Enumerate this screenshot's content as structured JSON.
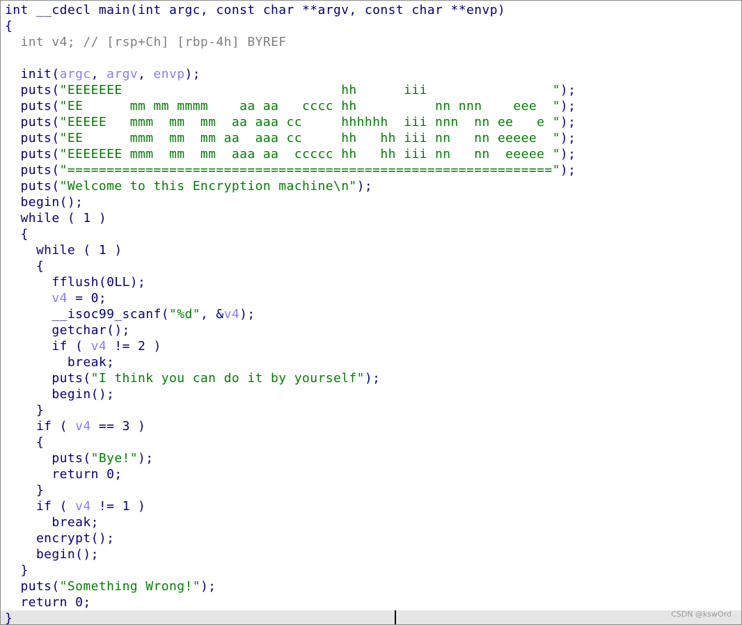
{
  "colors": {
    "kw": "#000080",
    "str": "#008000",
    "var": "#8080ff",
    "cmt": "#808080",
    "bg_current_line": "#e6e6e6"
  },
  "code_lines": [
    [
      {
        "t": "int __cdecl main(int argc, const char **argv, const char **envp)",
        "c": "kw"
      }
    ],
    [
      {
        "t": "{",
        "c": "kw"
      }
    ],
    [
      {
        "t": "  ",
        "c": "kw"
      },
      {
        "t": "int v4; // [rsp+Ch] [rbp-4h] BYREF",
        "c": "cmt"
      }
    ],
    [
      {
        "t": "",
        "c": "kw"
      }
    ],
    [
      {
        "t": "  init(",
        "c": "kw"
      },
      {
        "t": "argc",
        "c": "var"
      },
      {
        "t": ", ",
        "c": "kw"
      },
      {
        "t": "argv",
        "c": "var"
      },
      {
        "t": ", ",
        "c": "kw"
      },
      {
        "t": "envp",
        "c": "var"
      },
      {
        "t": ");",
        "c": "kw"
      }
    ],
    [
      {
        "t": "  puts(",
        "c": "kw"
      },
      {
        "t": "\"EEEEEEE                            hh      iii                \"",
        "c": "str"
      },
      {
        "t": ");",
        "c": "kw"
      }
    ],
    [
      {
        "t": "  puts(",
        "c": "kw"
      },
      {
        "t": "\"EE      mm mm mmmm    aa aa   cccc hh          nn nnn    eee  \"",
        "c": "str"
      },
      {
        "t": ");",
        "c": "kw"
      }
    ],
    [
      {
        "t": "  puts(",
        "c": "kw"
      },
      {
        "t": "\"EEEEE   mmm  mm  mm  aa aaa cc     hhhhhh  iii nnn  nn ee   e \"",
        "c": "str"
      },
      {
        "t": ");",
        "c": "kw"
      }
    ],
    [
      {
        "t": "  puts(",
        "c": "kw"
      },
      {
        "t": "\"EE      mmm  mm  mm aa  aaa cc     hh   hh iii nn   nn eeeee  \"",
        "c": "str"
      },
      {
        "t": ");",
        "c": "kw"
      }
    ],
    [
      {
        "t": "  puts(",
        "c": "kw"
      },
      {
        "t": "\"EEEEEEE mmm  mm  mm  aaa aa  ccccc hh   hh iii nn   nn  eeeee \"",
        "c": "str"
      },
      {
        "t": ");",
        "c": "kw"
      }
    ],
    [
      {
        "t": "  puts(",
        "c": "kw"
      },
      {
        "t": "\"==============================================================\"",
        "c": "str"
      },
      {
        "t": ");",
        "c": "kw"
      }
    ],
    [
      {
        "t": "  puts(",
        "c": "kw"
      },
      {
        "t": "\"Welcome to this Encryption machine\\n\"",
        "c": "str"
      },
      {
        "t": ");",
        "c": "kw"
      }
    ],
    [
      {
        "t": "  begin();",
        "c": "kw"
      }
    ],
    [
      {
        "t": "  while ( 1 )",
        "c": "kw"
      }
    ],
    [
      {
        "t": "  {",
        "c": "kw"
      }
    ],
    [
      {
        "t": "    while ( 1 )",
        "c": "kw"
      }
    ],
    [
      {
        "t": "    {",
        "c": "kw"
      }
    ],
    [
      {
        "t": "      fflush(0LL);",
        "c": "kw"
      }
    ],
    [
      {
        "t": "      ",
        "c": "kw"
      },
      {
        "t": "v4",
        "c": "var"
      },
      {
        "t": " = 0;",
        "c": "kw"
      }
    ],
    [
      {
        "t": "      __isoc99_scanf(",
        "c": "kw"
      },
      {
        "t": "\"%d\"",
        "c": "str"
      },
      {
        "t": ", &",
        "c": "kw"
      },
      {
        "t": "v4",
        "c": "var"
      },
      {
        "t": ");",
        "c": "kw"
      }
    ],
    [
      {
        "t": "      getchar();",
        "c": "kw"
      }
    ],
    [
      {
        "t": "      if ( ",
        "c": "kw"
      },
      {
        "t": "v4",
        "c": "var"
      },
      {
        "t": " != 2 )",
        "c": "kw"
      }
    ],
    [
      {
        "t": "        break;",
        "c": "kw"
      }
    ],
    [
      {
        "t": "      puts(",
        "c": "kw"
      },
      {
        "t": "\"I think you can do it by yourself\"",
        "c": "str"
      },
      {
        "t": ");",
        "c": "kw"
      }
    ],
    [
      {
        "t": "      begin();",
        "c": "kw"
      }
    ],
    [
      {
        "t": "    }",
        "c": "kw"
      }
    ],
    [
      {
        "t": "    if ( ",
        "c": "kw"
      },
      {
        "t": "v4",
        "c": "var"
      },
      {
        "t": " == 3 )",
        "c": "kw"
      }
    ],
    [
      {
        "t": "    {",
        "c": "kw"
      }
    ],
    [
      {
        "t": "      puts(",
        "c": "kw"
      },
      {
        "t": "\"Bye!\"",
        "c": "str"
      },
      {
        "t": ");",
        "c": "kw"
      }
    ],
    [
      {
        "t": "      return 0;",
        "c": "kw"
      }
    ],
    [
      {
        "t": "    }",
        "c": "kw"
      }
    ],
    [
      {
        "t": "    if ( ",
        "c": "kw"
      },
      {
        "t": "v4",
        "c": "var"
      },
      {
        "t": " != 1 )",
        "c": "kw"
      }
    ],
    [
      {
        "t": "      break;",
        "c": "kw"
      }
    ],
    [
      {
        "t": "    encrypt();",
        "c": "kw"
      }
    ],
    [
      {
        "t": "    begin();",
        "c": "kw"
      }
    ],
    [
      {
        "t": "  }",
        "c": "kw"
      }
    ],
    [
      {
        "t": "  puts(",
        "c": "kw"
      },
      {
        "t": "\"Something Wrong!\"",
        "c": "str"
      },
      {
        "t": ");",
        "c": "kw"
      }
    ],
    [
      {
        "t": "  return 0;",
        "c": "kw"
      }
    ],
    [
      {
        "t": "}",
        "c": "kw"
      }
    ]
  ],
  "current_line": 38,
  "watermark": "CSDN @kswOrd"
}
